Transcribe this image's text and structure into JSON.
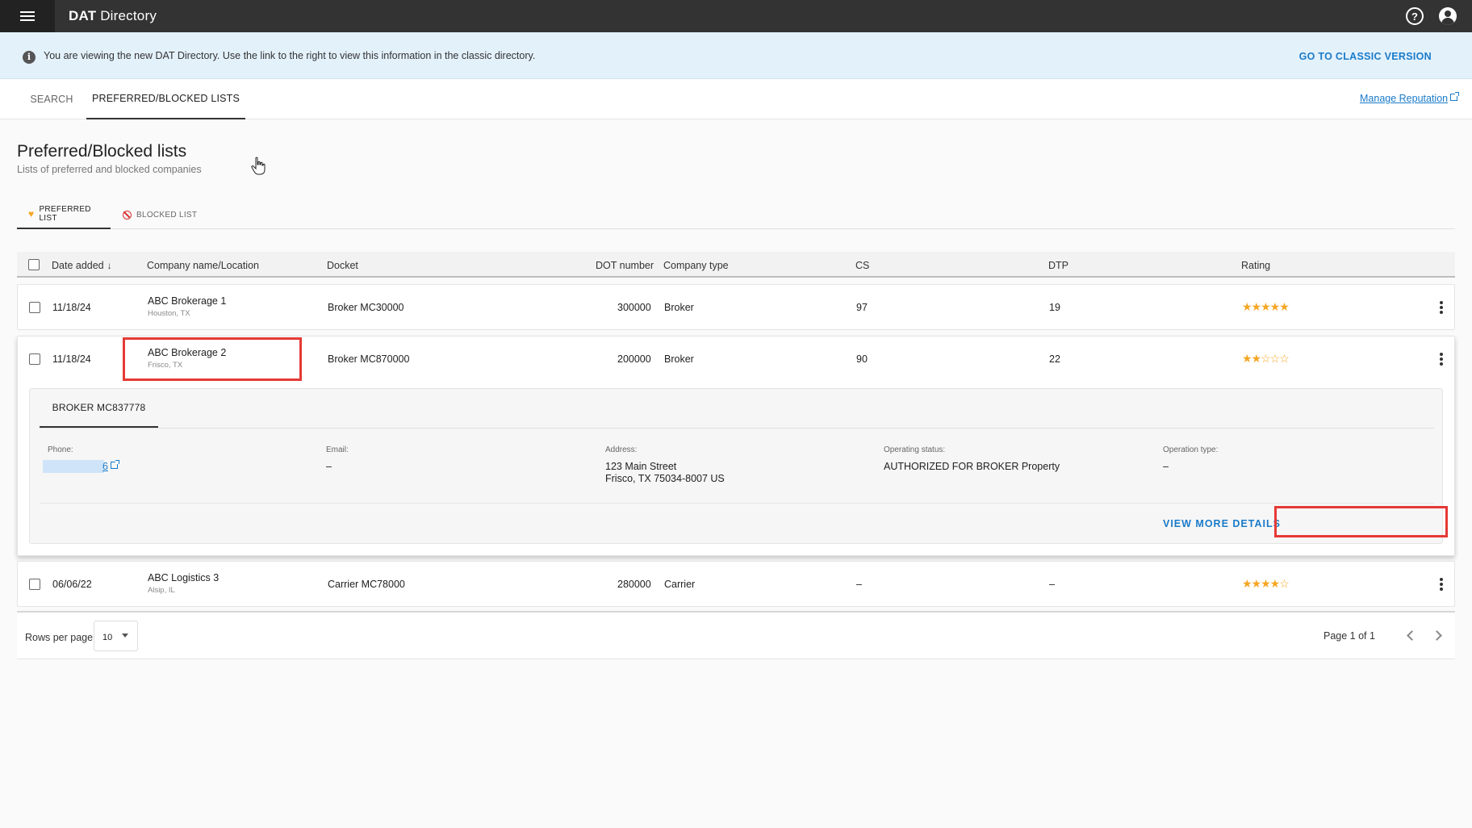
{
  "app": {
    "title_bold": "DAT",
    "title_rest": " Directory",
    "menu_icon": "hamburger-icon",
    "help_icon": "help-icon",
    "account_icon": "account-icon"
  },
  "banner": {
    "text": "You are viewing the new DAT Directory. Use the link to the right to view this information in the classic directory.",
    "link": "GO TO CLASSIC VERSION"
  },
  "main_tabs": [
    {
      "label": "SEARCH",
      "active": false
    },
    {
      "label": "PREFERRED/BLOCKED LISTS",
      "active": true
    }
  ],
  "manage_reputation": "Manage Reputation",
  "page": {
    "title": "Preferred/Blocked lists",
    "subtitle": "Lists of preferred and blocked companies"
  },
  "sub_tabs": [
    {
      "label": "PREFERRED LIST",
      "icon": "heart-icon",
      "active": true
    },
    {
      "label": "BLOCKED LIST",
      "icon": "block-icon",
      "active": false
    }
  ],
  "table": {
    "headers": {
      "date": "Date added",
      "company": "Company name/Location",
      "docket": "Docket",
      "dot": "DOT number",
      "type": "Company type",
      "cs": "CS",
      "dtp": "DTP",
      "rating": "Rating"
    },
    "rows": [
      {
        "date": "11/18/24",
        "company": "ABC Brokerage 1",
        "location": "Houston, TX",
        "docket": "Broker MC30000",
        "dot": "300000",
        "type": "Broker",
        "cs": "97",
        "dtp": "19",
        "rating": 5,
        "stars": "★★★★★"
      },
      {
        "date": "11/18/24",
        "company": "ABC Brokerage 2",
        "location": "Frisco, TX",
        "docket": "Broker MC870000",
        "dot": "200000",
        "type": "Broker",
        "cs": "90",
        "dtp": "22",
        "rating": 2,
        "stars": "★★☆☆☆"
      },
      {
        "date": "06/06/22",
        "company": "ABC Logistics 3",
        "location": "Alsip, IL",
        "docket": "Carrier MC78000",
        "dot": "280000",
        "type": "Carrier",
        "cs": "–",
        "dtp": "–",
        "rating": 4,
        "stars": "★★★★☆"
      }
    ]
  },
  "detail": {
    "tab": "BROKER MC837778",
    "phone_label": "Phone:",
    "phone_value": "6",
    "email_label": "Email:",
    "email_value": "–",
    "address_label": "Address:",
    "address_line1": "123 Main Street",
    "address_line2": "Frisco, TX 75034-8007 US",
    "status_label": "Operating status:",
    "status_value": "AUTHORIZED FOR BROKER Property",
    "optype_label": "Operation type:",
    "optype_value": "–",
    "view_more": "VIEW MORE DETAILS"
  },
  "pager": {
    "rows_label": "Rows per page",
    "rows_value": "10",
    "page_info": "Page 1 of 1"
  },
  "colors": {
    "topbar": "#333333",
    "accent": "#1a7bc9",
    "star": "#f5a623",
    "highlight_box": "#e53935"
  }
}
